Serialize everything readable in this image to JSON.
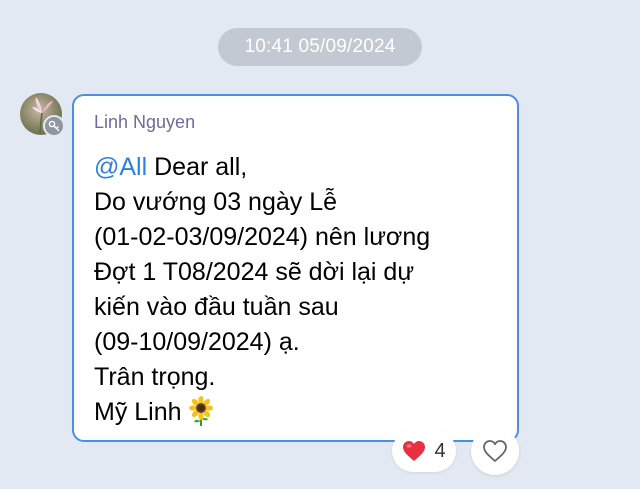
{
  "chat": {
    "timestamp": "10:41 05/09/2024"
  },
  "message": {
    "sender_name": "Linh Nguyen",
    "mention": "@All",
    "line1_rest": " Dear all,",
    "lines": [
      "Do vướng 03 ngày Lễ",
      "(01-02-03/09/2024) nên lương",
      "Đợt 1 T08/2024 sẽ dời lại dự",
      "kiến vào đầu tuần sau",
      "(09-10/09/2024) ạ.",
      "Trân trọng."
    ],
    "signature": "Mỹ Linh",
    "signature_emoji": "sunflower",
    "border_color": "#4a90e2",
    "mention_color": "#2f7fe0"
  },
  "reactions": {
    "emoji_icon": "red-heart-icon",
    "count": "4",
    "like_icon": "heart-outline-icon"
  },
  "avatar": {
    "badge_icon": "key-icon"
  }
}
